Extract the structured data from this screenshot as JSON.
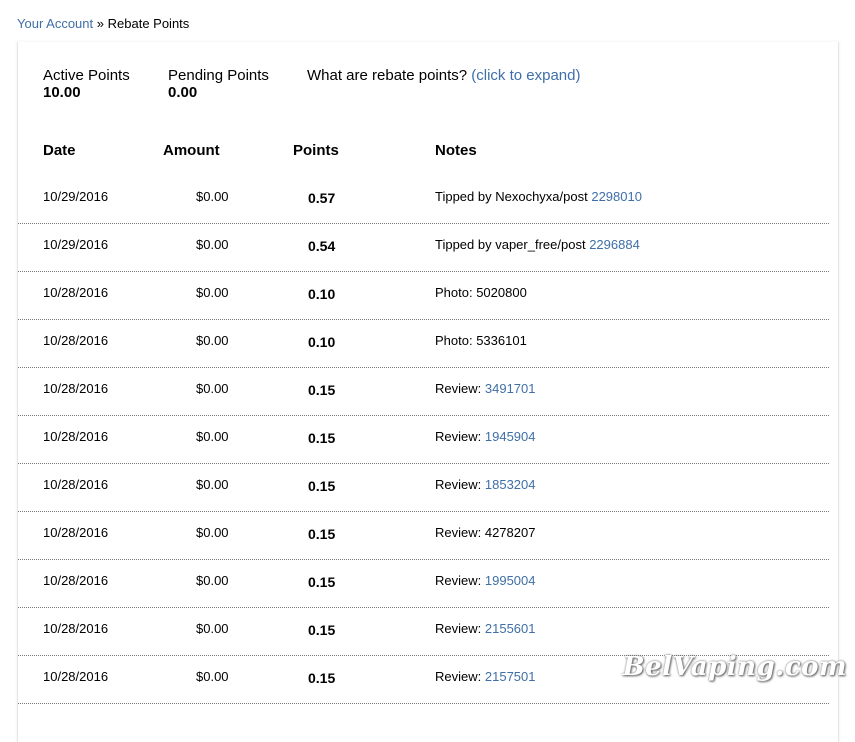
{
  "breadcrumb": {
    "parent": "Your Account",
    "separator": "»",
    "current": "Rebate Points"
  },
  "summary": {
    "active_label": "Active Points",
    "active_value": "10.00",
    "pending_label": "Pending Points",
    "pending_value": "0.00",
    "info_label": "What are rebate points?",
    "info_link": "(click to expand)"
  },
  "table": {
    "headers": {
      "date": "Date",
      "amount": "Amount",
      "points": "Points",
      "notes": "Notes"
    },
    "rows": [
      {
        "date": "10/29/2016",
        "amount": "$0.00",
        "points": "0.57",
        "note_text": "Tipped by Nexochyxa/post",
        "note_link": "2298010"
      },
      {
        "date": "10/29/2016",
        "amount": "$0.00",
        "points": "0.54",
        "note_text": "Tipped by vaper_free/post",
        "note_link": "2296884"
      },
      {
        "date": "10/28/2016",
        "amount": "$0.00",
        "points": "0.10",
        "note_text": "Photo: 5020800",
        "note_link": ""
      },
      {
        "date": "10/28/2016",
        "amount": "$0.00",
        "points": "0.10",
        "note_text": "Photo: 5336101",
        "note_link": ""
      },
      {
        "date": "10/28/2016",
        "amount": "$0.00",
        "points": "0.15",
        "note_text": "Review:",
        "note_link": "3491701"
      },
      {
        "date": "10/28/2016",
        "amount": "$0.00",
        "points": "0.15",
        "note_text": "Review:",
        "note_link": "1945904"
      },
      {
        "date": "10/28/2016",
        "amount": "$0.00",
        "points": "0.15",
        "note_text": "Review:",
        "note_link": "1853204"
      },
      {
        "date": "10/28/2016",
        "amount": "$0.00",
        "points": "0.15",
        "note_text": "Review: 4278207",
        "note_link": ""
      },
      {
        "date": "10/28/2016",
        "amount": "$0.00",
        "points": "0.15",
        "note_text": "Review:",
        "note_link": "1995004"
      },
      {
        "date": "10/28/2016",
        "amount": "$0.00",
        "points": "0.15",
        "note_text": "Review:",
        "note_link": "2155601"
      },
      {
        "date": "10/28/2016",
        "amount": "$0.00",
        "points": "0.15",
        "note_text": "Review:",
        "note_link": "2157501"
      }
    ]
  },
  "watermark": "BelVaping.com",
  "colors": {
    "link": "#3f6fa7",
    "divider": "#777777"
  }
}
